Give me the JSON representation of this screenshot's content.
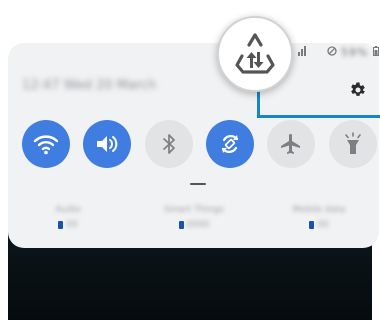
{
  "header": {
    "datetime": "12:47 Wed 20 March",
    "status_text": "59%"
  },
  "tiles": [
    {
      "name": "wifi",
      "state": "on"
    },
    {
      "name": "sound",
      "state": "on"
    },
    {
      "name": "bluetooth",
      "state": "off"
    },
    {
      "name": "auto-rotate",
      "state": "on"
    },
    {
      "name": "airplane-mode",
      "state": "off"
    },
    {
      "name": "flashlight",
      "state": "off"
    }
  ],
  "devices": [
    {
      "name": "Audio",
      "value": "00"
    },
    {
      "name": "Smart Things",
      "value": "0000"
    },
    {
      "name": "Mobile data",
      "value": "00"
    }
  ],
  "callout": {
    "icon": "mobile-data-icon"
  },
  "colors": {
    "accent": "#3f7ee0",
    "panel": "#f1f2f3",
    "callout_line": "#1586c8",
    "tile_off": "#e2e3e5"
  }
}
